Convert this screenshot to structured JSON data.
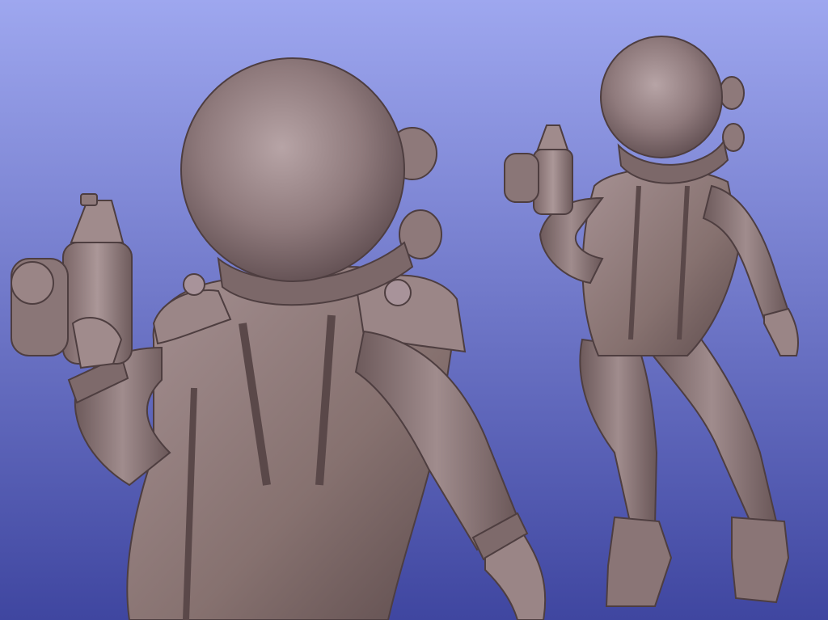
{
  "scene": {
    "background": {
      "top_color": "#9ea7ef",
      "bottom_color": "#3f46a0"
    },
    "model_color": "#8c7878",
    "figures": [
      {
        "id": "closeup",
        "subject": "astronaut-figure-back-closeup"
      },
      {
        "id": "full",
        "subject": "astronaut-figure-back-full"
      }
    ]
  }
}
